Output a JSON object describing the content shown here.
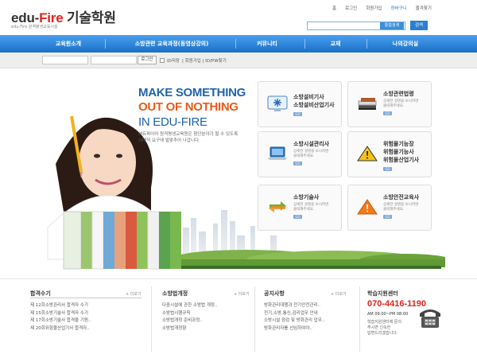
{
  "header": {
    "logo_text_1": "edu-",
    "logo_text_2": "Fire",
    "logo_text_3": " 기술학원",
    "logo_sub": "edu-Fire 원격평생교육시설",
    "top_links": [
      "홈",
      "로그인",
      "회원가입",
      "장바구니",
      "즐겨찾기"
    ],
    "search_button": "통합검색",
    "go_button": "검색"
  },
  "nav": {
    "items": [
      "교육원소개",
      "소방관련 교육과정(동영상강의)",
      "커뮤니티",
      "교재",
      "나의강의실"
    ]
  },
  "login": {
    "login_button": "로그인",
    "save_id": "ID저장",
    "links": "| 회원가입 | ID/PW찾기"
  },
  "hero": {
    "line1": "MAKE SOMETHING",
    "line2": "OUT OF NOTHING",
    "line3": "IN EDU-FIRE",
    "desc_1": "에듀파이어 원격평생교육원은 첨단분야가 될 수 있도록",
    "desc_2": "시대적 요구에 발맞추어 나갑니다."
  },
  "cards": [
    {
      "title_1": "소방설비기사",
      "title_2": "소방설비산업기사",
      "desc_1": "",
      "desc_2": "",
      "go": "GO"
    },
    {
      "title_1": "소방관련법령",
      "title_2": "",
      "desc_1": "상세한 설명을 보시려면",
      "desc_2": "클릭해주세요.",
      "go": "GO"
    },
    {
      "title_1": "소방시설관리사",
      "title_2": "",
      "desc_1": "상세한 설명을 보시려면",
      "desc_2": "클릭해주세요.",
      "go": "GO"
    },
    {
      "title_1": "위험물기능장",
      "title_2": "위험물기능사",
      "title_3": "위험물산업기사",
      "desc_1": "",
      "desc_2": "",
      "go": "GO"
    },
    {
      "title_1": "소방기술사",
      "title_2": "",
      "desc_1": "상세한 설명을 보시려면",
      "desc_2": "클릭해주세요.",
      "go": "GO"
    },
    {
      "title_1": "소방안전교육사",
      "title_2": "",
      "desc_1": "상세한 설명을 보시려면",
      "desc_2": "클릭해주세요.",
      "go": "GO"
    }
  ],
  "bottom": {
    "section1": {
      "title": "합격수기",
      "more": "+ 더보기",
      "items": [
        "제 12회소방관리사 합격자 수기",
        "제 15회소방기술사 합격자 수기",
        "제 17회소방기술사 합격을 기원..",
        "제 20회위험물산업기사 합격자.."
      ]
    },
    "section2": {
      "title": "소방법개정",
      "more": "+ 더보기",
      "items": [
        "다중시설에 관한 소방법 개정..",
        "소방법시행규칙",
        "소방법개정 준비과정..",
        "소방법개정향"
      ]
    },
    "section3": {
      "title": "공지사항",
      "more": "+ 더보기",
      "items": [
        "방화관리대행과 전기안전관리..",
        "전기,소방,통신,감리업무 안내",
        "소방시설 점검 및 방화관리 업무..",
        "방화관리자를 선임하여야.."
      ]
    },
    "contact": {
      "title": "학습지원센터",
      "phone": "070-4416-1190",
      "hours": "AM 09:00~PM 08:00",
      "note_1": "학습지원센터에 문의",
      "note_2": "주시면 신속한",
      "note_3": "답변드리겠습니다."
    }
  }
}
